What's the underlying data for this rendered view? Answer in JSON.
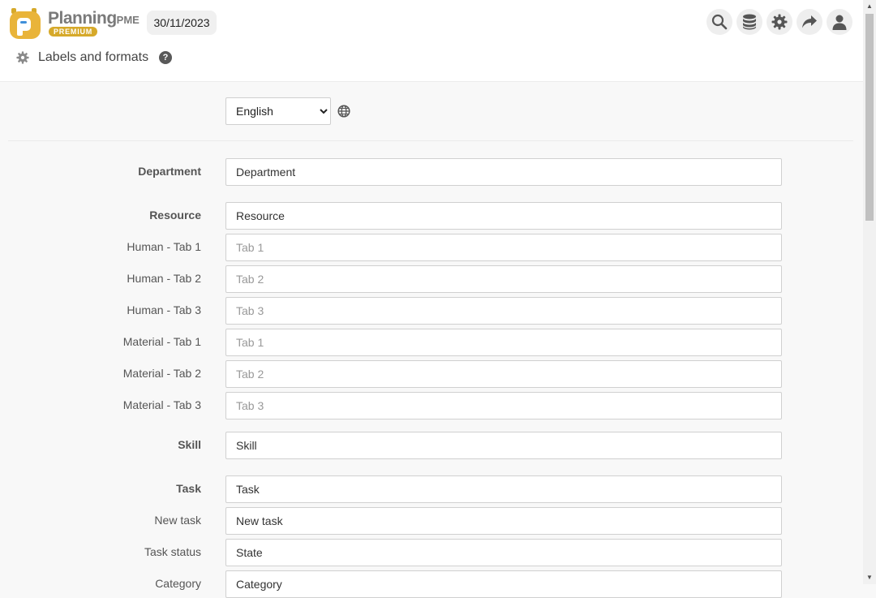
{
  "app": {
    "brand_name": "Planning",
    "brand_suffix": "PME",
    "brand_badge": "PREMIUM",
    "date": "30/11/2023",
    "accent_color": "#d6a92a"
  },
  "toolbar": {
    "icons": [
      "search-icon",
      "database-icon",
      "gear-icon",
      "share-icon",
      "user-icon"
    ]
  },
  "page": {
    "title": "Labels and formats",
    "help_symbol": "?"
  },
  "language": {
    "selected": "English",
    "options": [
      "English"
    ]
  },
  "fields": [
    {
      "label": "Department",
      "value": "Department",
      "placeholder": "",
      "bold": true
    },
    {
      "label": "Resource",
      "value": "Resource",
      "placeholder": "",
      "bold": true
    },
    {
      "label": "Human - Tab 1",
      "value": "",
      "placeholder": "Tab 1",
      "bold": false
    },
    {
      "label": "Human - Tab 2",
      "value": "",
      "placeholder": "Tab 2",
      "bold": false
    },
    {
      "label": "Human - Tab 3",
      "value": "",
      "placeholder": "Tab 3",
      "bold": false
    },
    {
      "label": "Material - Tab 1",
      "value": "",
      "placeholder": "Tab 1",
      "bold": false
    },
    {
      "label": "Material - Tab 2",
      "value": "",
      "placeholder": "Tab 2",
      "bold": false
    },
    {
      "label": "Material - Tab 3",
      "value": "",
      "placeholder": "Tab 3",
      "bold": false
    },
    {
      "label": "Skill",
      "value": "Skill",
      "placeholder": "",
      "bold": true
    },
    {
      "label": "Task",
      "value": "Task",
      "placeholder": "",
      "bold": true
    },
    {
      "label": "New task",
      "value": "New task",
      "placeholder": "",
      "bold": false
    },
    {
      "label": "Task status",
      "value": "State",
      "placeholder": "",
      "bold": false
    },
    {
      "label": "Category",
      "value": "Category",
      "placeholder": "",
      "bold": false
    }
  ]
}
